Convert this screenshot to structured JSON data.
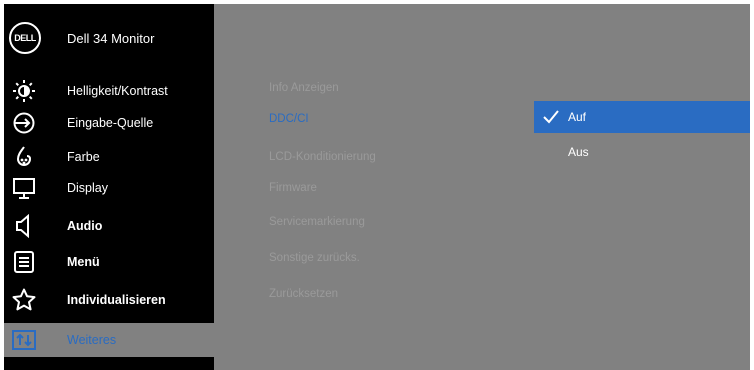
{
  "header": {
    "logo_text": "DELL",
    "title": "Dell 34 Monitor"
  },
  "nav": [
    {
      "label": "Helligkeit/Kontrast",
      "icon": "brightness-icon"
    },
    {
      "label": "Eingabe-Quelle",
      "icon": "input-source-icon"
    },
    {
      "label": "Farbe",
      "icon": "color-icon"
    },
    {
      "label": "Display",
      "icon": "display-icon"
    },
    {
      "label": "Audio",
      "icon": "speaker-icon"
    },
    {
      "label": "Menü",
      "icon": "menu-icon"
    },
    {
      "label": "Individualisieren",
      "icon": "star-icon"
    },
    {
      "label": "Weiteres",
      "icon": "others-icon"
    }
  ],
  "submenu": [
    "Info Anzeigen",
    "DDC/CI",
    "LCD-Konditionierung",
    "Firmware",
    "Servicemarkierung",
    "Sonstige zurücks.",
    "Zurücksetzen"
  ],
  "options": [
    {
      "label": "Auf",
      "selected": true
    },
    {
      "label": "Aus",
      "selected": false
    }
  ],
  "colors": {
    "accent": "#2a6cc2",
    "panel": "#818181",
    "sidebar": "#000000"
  }
}
